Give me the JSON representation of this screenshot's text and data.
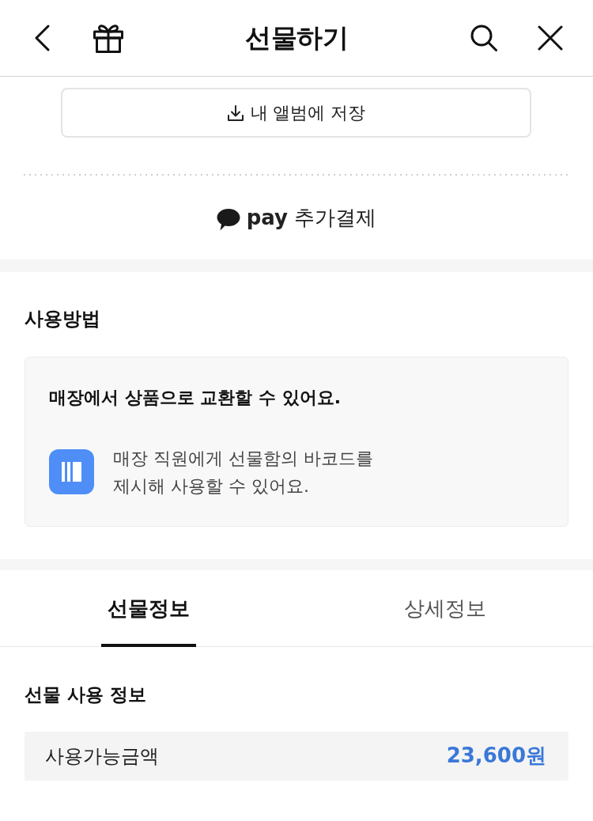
{
  "header": {
    "title": "선물하기"
  },
  "save_button": {
    "label": "내 앨범에 저장"
  },
  "payment": {
    "label": "**pay** 추가결제"
  },
  "usage": {
    "title": "사용방법",
    "card": {
      "headline": "매장에서 상품으로 교환할 수 있어요.",
      "steps": [
        {
          "text": "매장 직원에게 선물함의 바코드를\n제시해 사용할 수 있어요."
        }
      ]
    }
  },
  "tabs": [
    {
      "label": "선물정보",
      "selected": true
    },
    {
      "label": "상세정보",
      "selected": false
    }
  ],
  "gift_info": {
    "title": "선물 사용 정보",
    "rows": [
      {
        "label": "사용가능금액",
        "value": "23,600원"
      }
    ]
  }
}
